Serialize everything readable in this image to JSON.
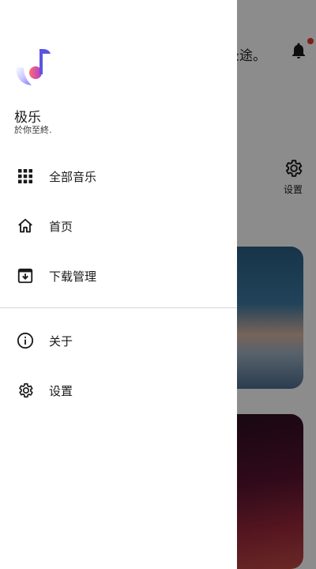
{
  "background": {
    "topbar_text": "录途。",
    "settings_shortcut_label": "设置"
  },
  "drawer": {
    "app_name": "极乐",
    "app_slogan": "於你至終.",
    "menu": [
      {
        "label": "全部音乐",
        "icon": "grid-icon"
      },
      {
        "label": "首页",
        "icon": "home-icon"
      },
      {
        "label": "下载管理",
        "icon": "download-box-icon"
      },
      {
        "label": "关于",
        "icon": "info-icon"
      },
      {
        "label": "设置",
        "icon": "gear-icon"
      }
    ]
  },
  "colors": {
    "accent": "#e53935",
    "scrim": "rgba(0,0,0,0.45)"
  }
}
